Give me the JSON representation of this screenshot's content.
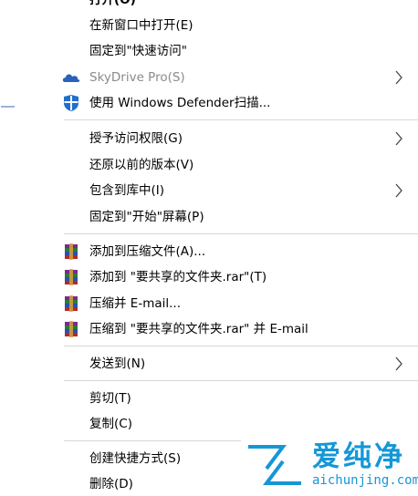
{
  "menu": {
    "items": [
      {
        "label": "打开(O)"
      },
      {
        "label": "在新窗口中打开(E)"
      },
      {
        "label": "固定到\"快速访问\""
      },
      {
        "label": "SkyDrive Pro(S)"
      },
      {
        "label": "使用 Windows Defender扫描..."
      },
      {
        "label": "授予访问权限(G)"
      },
      {
        "label": "还原以前的版本(V)"
      },
      {
        "label": "包含到库中(I)"
      },
      {
        "label": "固定到\"开始\"屏幕(P)"
      },
      {
        "label": "添加到压缩文件(A)..."
      },
      {
        "label": "添加到 \"要共享的文件夹.rar\"(T)"
      },
      {
        "label": "压缩并 E-mail..."
      },
      {
        "label": "压缩到 \"要共享的文件夹.rar\" 并 E-mail"
      },
      {
        "label": "发送到(N)"
      },
      {
        "label": "剪切(T)"
      },
      {
        "label": "复制(C)"
      },
      {
        "label": "创建快捷方式(S)"
      },
      {
        "label": "删除(D)"
      }
    ]
  },
  "watermark": {
    "title": "爱纯净",
    "url": "aichunjing.com"
  },
  "colors": {
    "separator": "#d7d7d7",
    "disabled_text": "#8b8b8b",
    "watermark_blue": "#1597d6",
    "defender_blue": "#1f6fcd"
  }
}
